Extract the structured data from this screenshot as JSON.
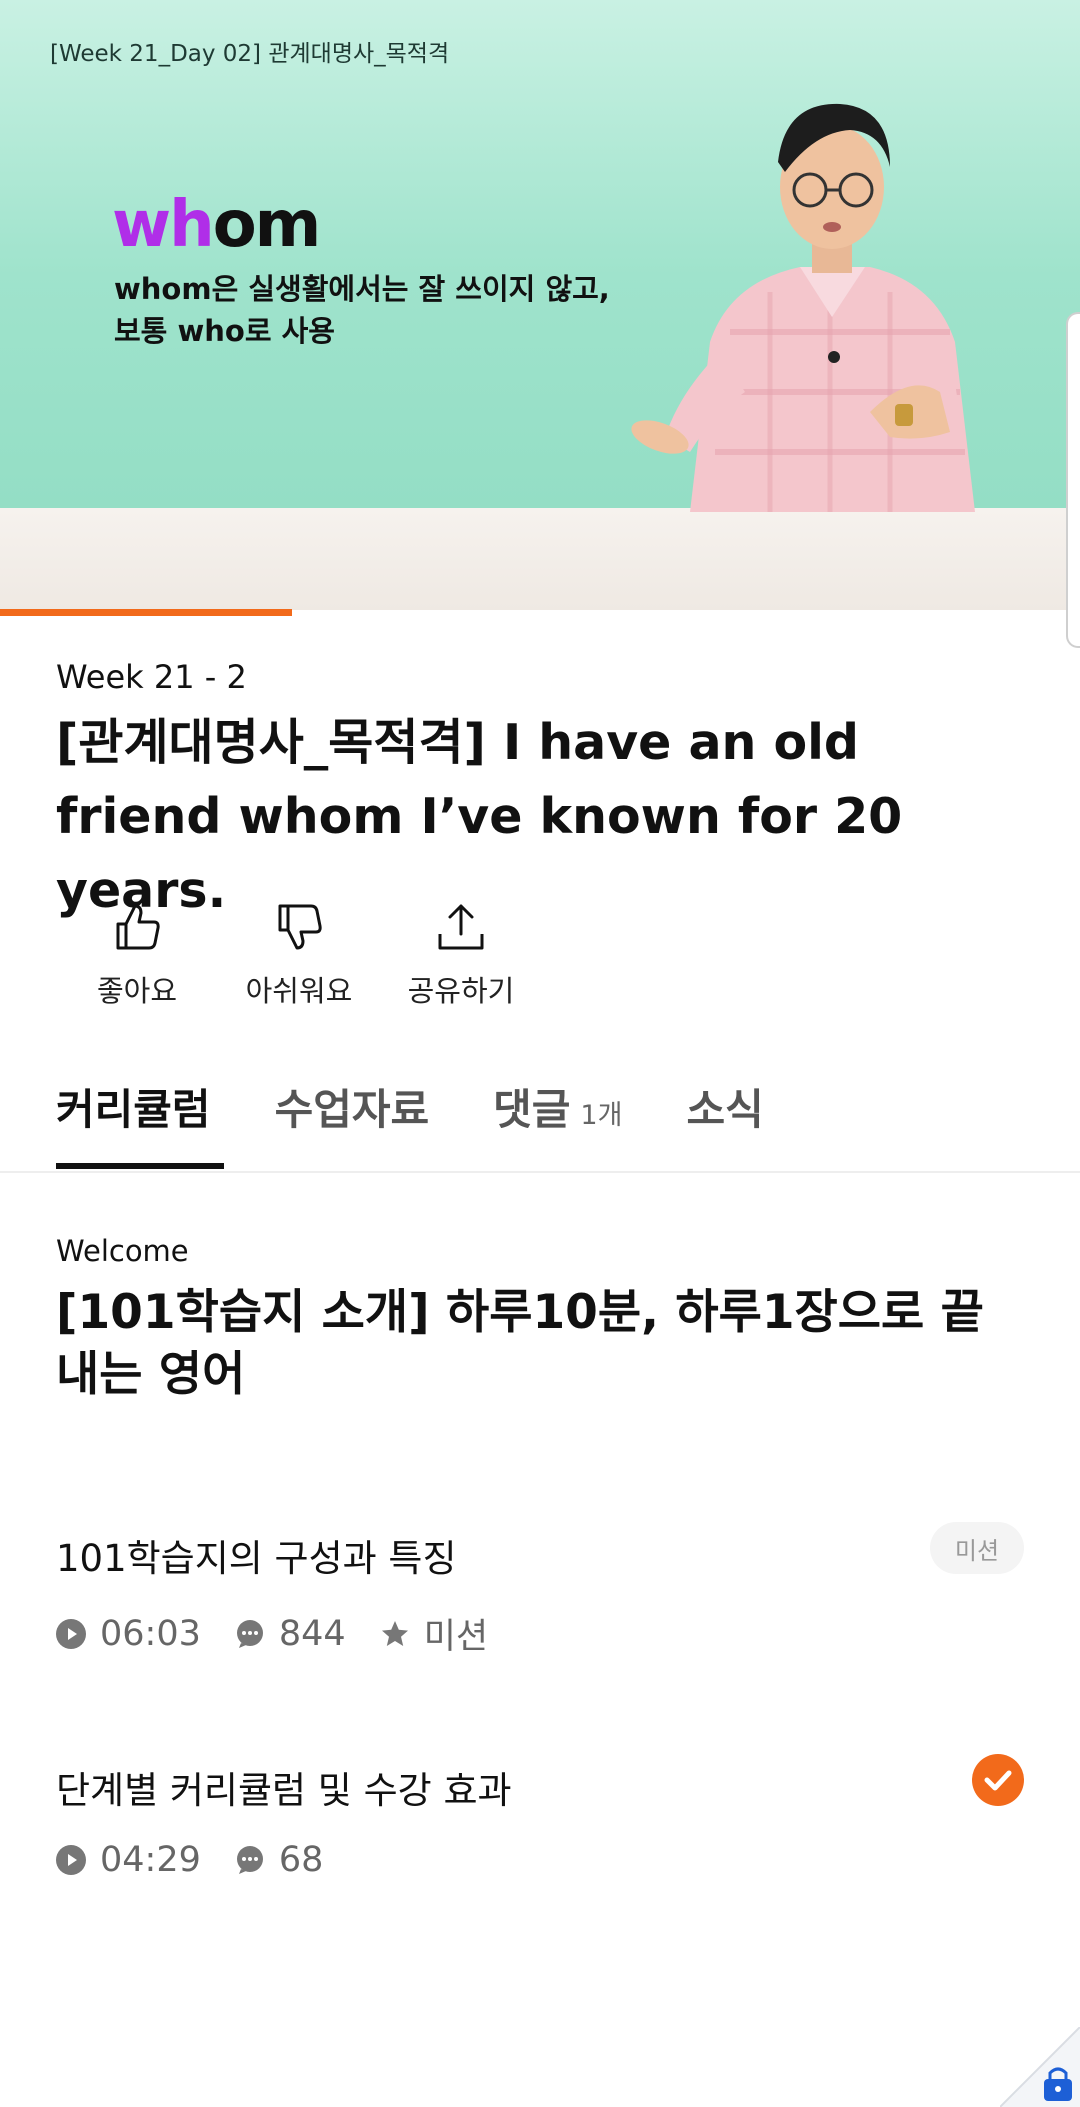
{
  "video": {
    "title": "[Week 21_Day 02] 관계대명사_목적격",
    "word_highlight": "wh",
    "word_rest": "om",
    "caption_line1": "whom은 실생활에서는 잘 쓰이지 않고,",
    "caption_line2": "보통 who로 사용",
    "progress": 0.27,
    "progress_color": "#f26a1b"
  },
  "lesson": {
    "week": "Week 21 - 2",
    "title": "[관계대명사_목적격] I have an old friend whom I’ve known for 20 years."
  },
  "actions": [
    {
      "icon": "thumbs-up-icon",
      "label": "좋아요"
    },
    {
      "icon": "thumbs-down-icon",
      "label": "아쉬워요"
    },
    {
      "icon": "share-icon",
      "label": "공유하기"
    }
  ],
  "tabs": [
    {
      "label": "커리큘럼",
      "active": true
    },
    {
      "label": "수업자료"
    },
    {
      "label": "댓글",
      "count": "1개"
    },
    {
      "label": "소식"
    }
  ],
  "curriculum": {
    "section_label": "Welcome",
    "section_title": "[101학습지 소개] 하루10분, 하루1장으로 끝내는 영어",
    "items": [
      {
        "title": "101학습지의 구성과 특징",
        "duration": "06:03",
        "comments": "844",
        "mission": "미션",
        "badge": "미션"
      },
      {
        "title": "단계별 커리큘럼 및 수강 효과",
        "duration": "04:29",
        "comments": "68",
        "completed": true
      }
    ]
  },
  "colors": {
    "accent": "#f26a1b",
    "text": "#111111",
    "muted": "#666666"
  }
}
